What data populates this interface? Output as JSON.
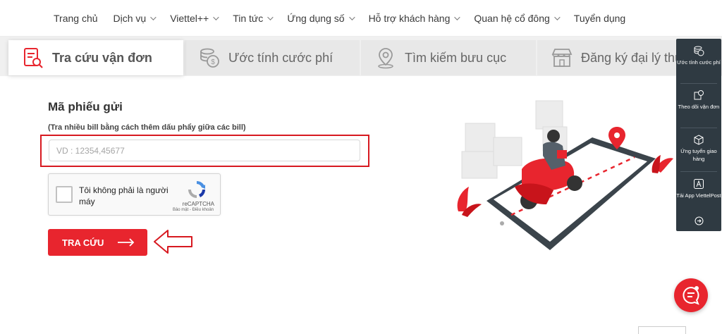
{
  "nav": {
    "items": [
      {
        "label": "Trang chủ",
        "dropdown": false
      },
      {
        "label": "Dịch vụ",
        "dropdown": true
      },
      {
        "label": "Viettel++",
        "dropdown": true
      },
      {
        "label": "Tin tức",
        "dropdown": true
      },
      {
        "label": "Ứng dụng số",
        "dropdown": true
      },
      {
        "label": "Hỗ trợ khách hàng",
        "dropdown": true
      },
      {
        "label": "Quan hệ cổ đông",
        "dropdown": true
      },
      {
        "label": "Tuyển dụng",
        "dropdown": false
      }
    ]
  },
  "tabs": [
    {
      "label": "Tra cứu vận đơn",
      "icon": "tracking-search-icon",
      "active": true
    },
    {
      "label": "Ước tính cước phí",
      "icon": "coins-icon",
      "active": false
    },
    {
      "label": "Tìm kiếm bưu cục",
      "icon": "location-pin-icon",
      "active": false
    },
    {
      "label": "Đăng ký đại lý thu gom",
      "icon": "shop-icon",
      "active": false
    }
  ],
  "form": {
    "title": "Mã phiếu gửi",
    "hint": "(Tra nhiều bill bằng cách thêm dấu phẩy giữa các bill)",
    "input_placeholder": "VD : 12354,45677",
    "input_value": "",
    "button_label": "TRA CỨU"
  },
  "captcha": {
    "label": "Tôi không phải là người máy",
    "brand": "reCAPTCHA",
    "links": "Bảo mật - Điều khoản"
  },
  "side_widget": {
    "items": [
      {
        "label": "Ước tính cước phí",
        "icon": "coins-icon"
      },
      {
        "label": "Theo dõi vận đơn",
        "icon": "tracking-icon"
      },
      {
        "label": "Ứng tuyển giao hàng",
        "icon": "package-icon"
      },
      {
        "label": "Tải App ViettelPost",
        "icon": "app-store-icon"
      }
    ]
  },
  "colors": {
    "accent": "#e8252e",
    "highlight": "#d71920",
    "sidebar": "#2f3a42"
  }
}
